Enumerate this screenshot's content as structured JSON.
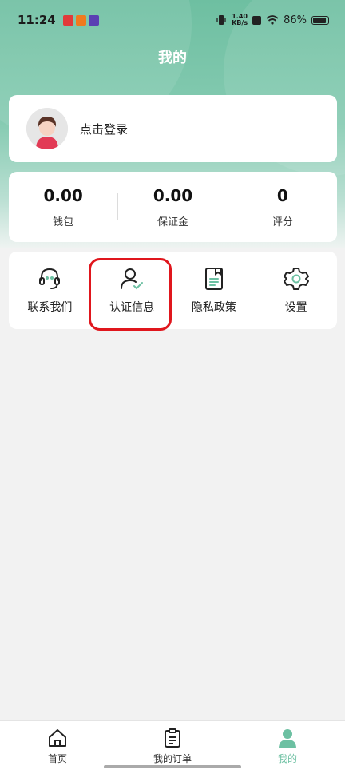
{
  "status_bar": {
    "time": "11:24",
    "net_speed_value": "1.40",
    "net_speed_unit": "KB/s",
    "battery": "86%",
    "notification_colors": [
      "#e13a3a",
      "#f07a1e",
      "#5b3fb3"
    ]
  },
  "header": {
    "title": "我的"
  },
  "login": {
    "prompt": "点击登录"
  },
  "stats": [
    {
      "value": "0.00",
      "label": "钱包"
    },
    {
      "value": "0.00",
      "label": "保证金"
    },
    {
      "value": "0",
      "label": "评分"
    }
  ],
  "menu": [
    {
      "label": "联系我们",
      "icon": "headset-icon"
    },
    {
      "label": "认证信息",
      "icon": "verified-user-icon"
    },
    {
      "label": "隐私政策",
      "icon": "document-icon"
    },
    {
      "label": "设置",
      "icon": "gear-icon"
    }
  ],
  "tabbar": [
    {
      "label": "首页",
      "icon": "home-icon"
    },
    {
      "label": "我的订单",
      "icon": "clipboard-icon"
    },
    {
      "label": "我的",
      "icon": "user-icon",
      "active": true
    }
  ],
  "colors": {
    "accent": "#6cc0a2",
    "highlight": "#e0161d"
  }
}
